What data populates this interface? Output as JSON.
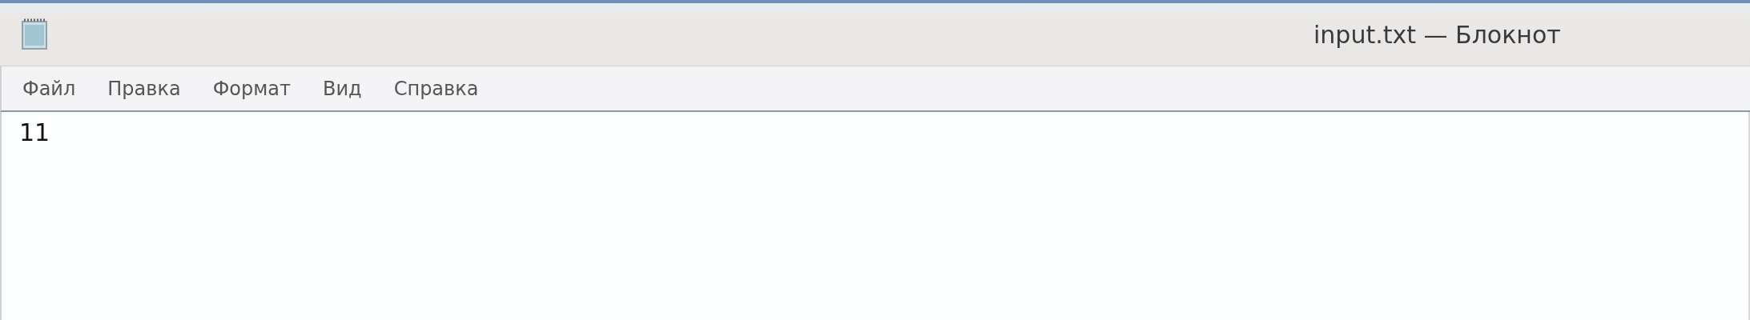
{
  "window": {
    "title": "input.txt — Блокнот"
  },
  "menu": [
    "Файл",
    "Правка",
    "Формат",
    "Вид",
    "Справка"
  ],
  "editor": {
    "text": "11"
  }
}
